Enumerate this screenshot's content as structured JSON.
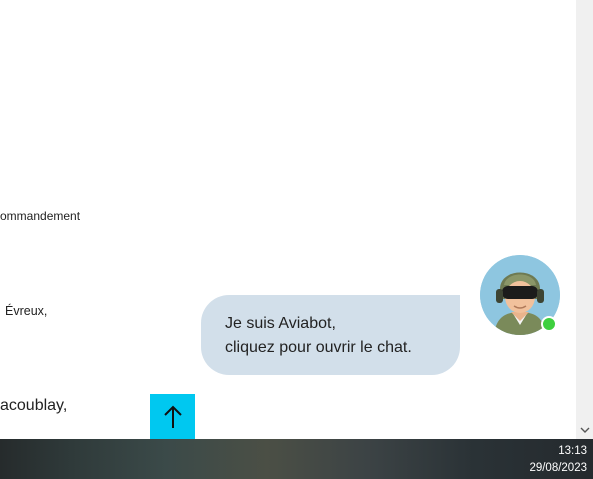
{
  "page": {
    "text_commandement": "ommandement",
    "text_evreux": "Évreux,",
    "text_villacoublay": "acoublay,"
  },
  "chat": {
    "line1": "Je suis Aviabot,",
    "line2": "cliquez pour ouvrir le chat.",
    "bubble_color": "#d2dfea",
    "avatar_status": "online"
  },
  "back_to_top": {
    "icon": "arrow-up-icon",
    "color": "#00c8f0"
  },
  "taskbar": {
    "time": "13:13",
    "date": "29/08/2023"
  }
}
